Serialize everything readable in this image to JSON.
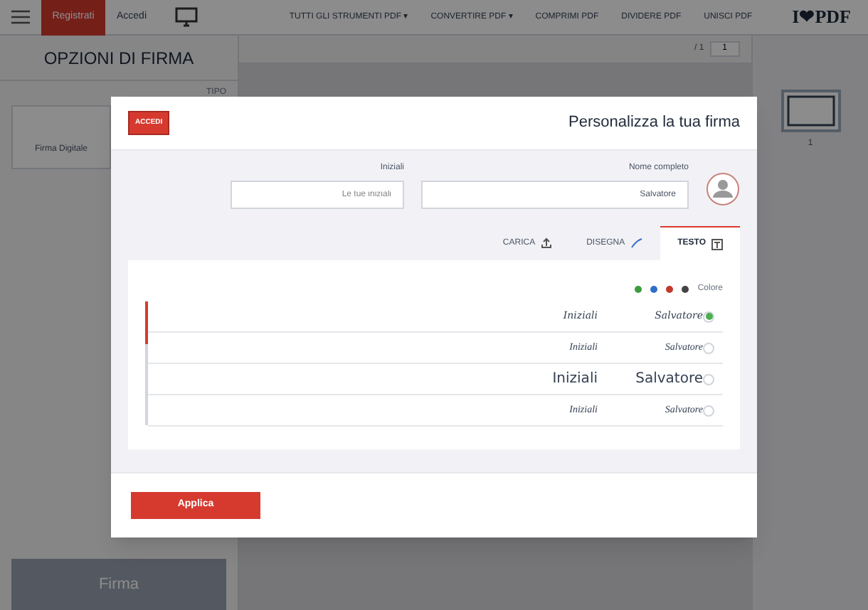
{
  "navbar": {
    "logo": "I❤PDF",
    "links": [
      "TUTTI GLI STRUMENTI PDF ▾",
      "CONVERTIRE PDF ▾",
      "COMPRIMI PDF",
      "DIVIDERE PDF",
      "UNISCI PDF"
    ],
    "login": "Accedi",
    "register": "Registrati"
  },
  "sidebar": {
    "title": "OPZIONI DI FIRMA",
    "type_label": "TIPO",
    "type_option": "Firma Digitale",
    "sign_button": "Firma"
  },
  "viewer": {
    "page_count": "/ 1",
    "page_number": "1",
    "thumbnail_label": "1"
  },
  "dialog": {
    "title": "Personalizza la tua firma",
    "login_button": "ACCEDI",
    "full_name": {
      "label": "Nome completo",
      "value": "Salvatore"
    },
    "initials": {
      "label": "Iniziali",
      "placeholder": "Le tue iniziali"
    },
    "tabs": [
      {
        "label": "CARICA",
        "kind": "upload",
        "selected": false
      },
      {
        "label": "DISEGNA",
        "kind": "draw",
        "selected": false
      },
      {
        "label": "TESTO",
        "kind": "text",
        "selected": true
      }
    ],
    "color_label": "Colore",
    "colors": [
      {
        "color": "#3d9b3d"
      },
      {
        "color": "#2f6fc9"
      },
      {
        "color": "#c0392b"
      },
      {
        "color": "#444444"
      }
    ],
    "styles": [
      {
        "name": "Salvatore",
        "initials": "Iniziali",
        "kind": "script",
        "selected": true
      },
      {
        "name": "Salvatore",
        "initials": "Iniziali",
        "kind": "italic",
        "selected": false
      },
      {
        "name": "Salvatore",
        "initials": "Iniziali",
        "kind": "plain",
        "selected": false
      },
      {
        "name": "Salvatore",
        "initials": "Iniziali",
        "kind": "hand",
        "selected": false
      }
    ],
    "apply_button": "Applica"
  }
}
